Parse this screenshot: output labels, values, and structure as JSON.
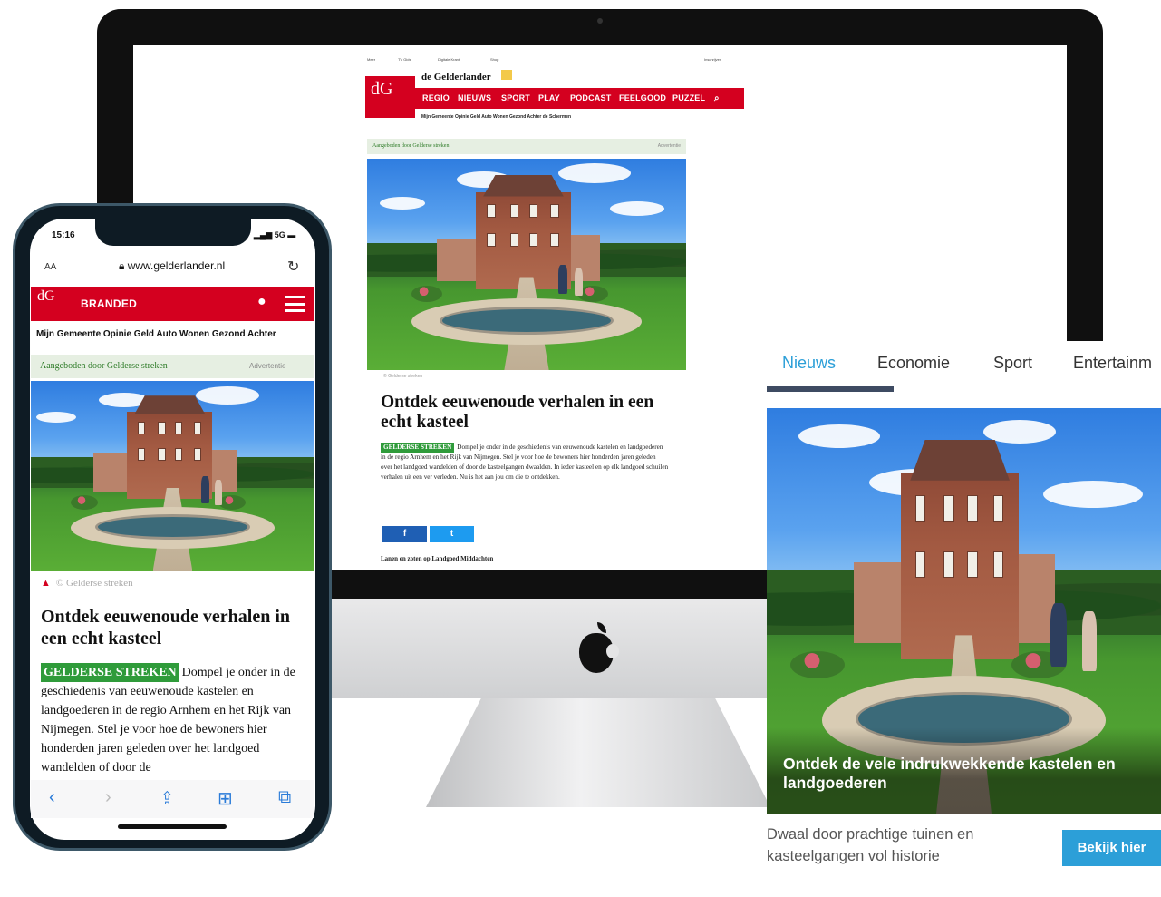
{
  "desktop_site": {
    "topbar": [
      "Meer",
      "TV Gids",
      "Digitale Krant",
      "Shop",
      "Inschrijven"
    ],
    "logo_text": "dG",
    "brand_name": "de Gelderlander",
    "nav": [
      "REGIO",
      "NIEUWS",
      "SPORT",
      "PLAY",
      "PODCAST",
      "FEELGOOD",
      "PUZZEL"
    ],
    "subnav": "Mijn Gemeente   Opinie   Geld   Auto   Wonen   Gezond   Achter de Schermen",
    "advert_label": "Aangeboden door Gelderse streken",
    "advert_note": "Advertentie",
    "credit": "© Gelderse streken",
    "title": "Ontdek eeuwenoude verhalen in een echt kasteel",
    "tag": "GELDERSE STREKEN",
    "body": "Dompel je onder in de geschiedenis van eeuwenoude kastelen en landgoederen in de regio Arnhem en het Rijk van Nijmegen. Stel je voor hoe de bewoners hier honderden jaren geleden over het landgoed wandelden of door de kasteelgangen dwaalden. In ieder kasteel en op elk landgoed schuilen verhalen uit een ver verleden. Nu is het aan jou om die te ontdekken.",
    "share_facebook": "f",
    "share_twitter": "t",
    "photo_caption": "Lanen en zoten op Landgoed Middachten"
  },
  "phone": {
    "time": "15:16",
    "status": "5G",
    "aa": "AA",
    "url": "www.gelderlander.nl",
    "reload_icon": "↻",
    "logo_text": "dG",
    "section": "BRANDED",
    "subnav": "Mijn Gemeente  Opinie  Geld  Auto  Wonen  Gezond  Achter",
    "advert_label": "Aangeboden door Gelderse streken",
    "advert_note": "Advertentie",
    "credit": "© Gelderse streken",
    "title": "Ontdek eeuwenoude verhalen in een echt kasteel",
    "tag": "GELDERSE STREKEN",
    "body": "Dompel je onder in de geschiedenis van eeuwenoude kastelen en landgoederen in de regio Arnhem en het Rijk van Nijmegen. Stel je voor hoe de bewoners hier honderden jaren geleden over het landgoed wandelden of door de",
    "toolbar": [
      "‹",
      "›",
      "⇪",
      "⊞",
      "⧉"
    ]
  },
  "card": {
    "tabs": [
      "Nieuws",
      "Economie",
      "Sport",
      "Entertainm"
    ],
    "headline": "Ontdek de vele indrukwekkende kastelen en landgoederen",
    "description": "Dwaal door prachtige tuinen en kasteelgangen vol historie",
    "cta": "Bekijk hier"
  },
  "colors": {
    "brand_red": "#d4001f",
    "tag_green": "#2f9b3a",
    "cta_blue": "#2c9fd8",
    "tab_active": "#2c9fd8"
  }
}
